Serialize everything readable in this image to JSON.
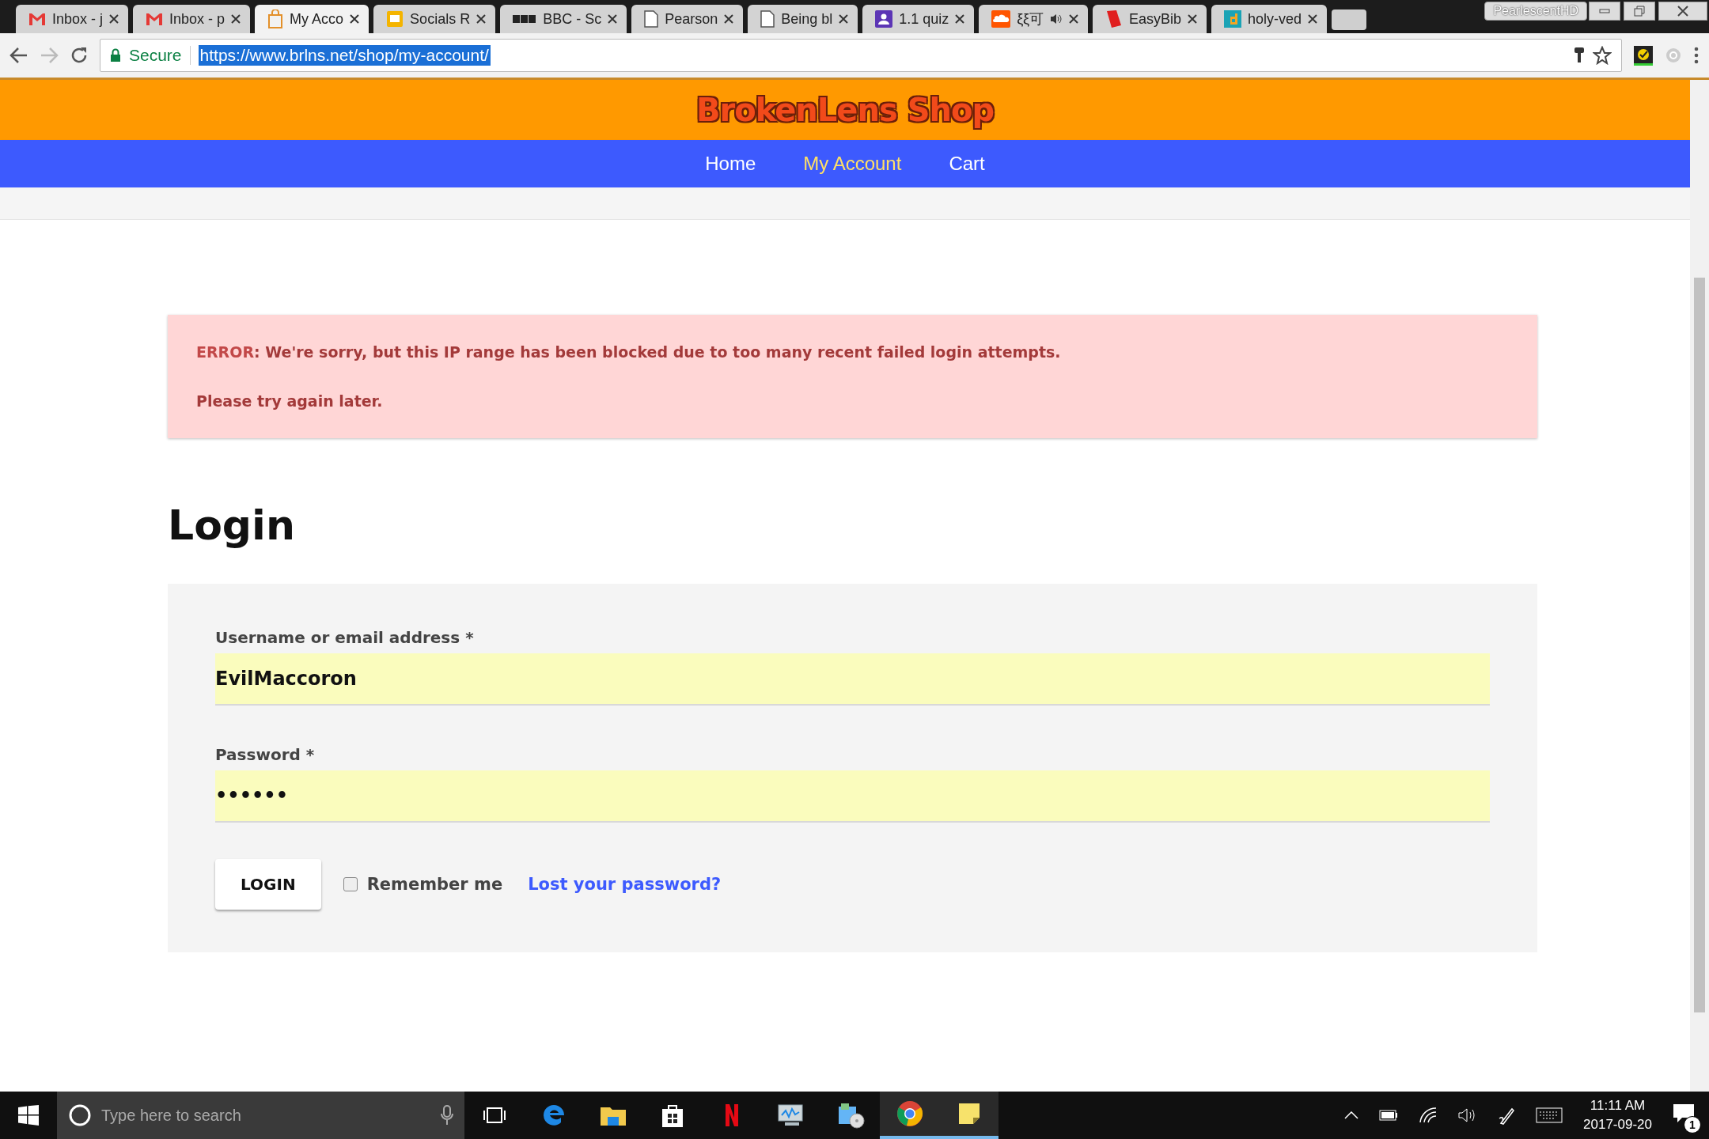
{
  "browser": {
    "tabs": [
      {
        "label": "Inbox - j",
        "selected": false,
        "audio": false
      },
      {
        "label": "Inbox - p",
        "selected": false,
        "audio": false
      },
      {
        "label": "My Acco",
        "selected": true,
        "audio": false
      },
      {
        "label": "Socials R",
        "selected": false,
        "audio": false
      },
      {
        "label": "BBC - Sc",
        "selected": false,
        "audio": false
      },
      {
        "label": "Pearson",
        "selected": false,
        "audio": false
      },
      {
        "label": "Being bl",
        "selected": false,
        "audio": false
      },
      {
        "label": "1.1 quiz",
        "selected": false,
        "audio": false
      },
      {
        "label": "ξξ可",
        "selected": false,
        "audio": true
      },
      {
        "label": "EasyBib",
        "selected": false,
        "audio": false
      },
      {
        "label": "holy-ved",
        "selected": false,
        "audio": false
      }
    ],
    "profile": "PearlescentHD",
    "secure_label": "Secure",
    "url": {
      "value": "https://www.brlns.net/shop/my-account/",
      "selected": true
    }
  },
  "site": {
    "logo": "BrokenLens Shop",
    "nav": [
      {
        "label": "Home",
        "selected": false
      },
      {
        "label": "My Account",
        "selected": true
      },
      {
        "label": "Cart",
        "selected": false
      }
    ]
  },
  "error": {
    "lines": [
      "**ERROR**: We're sorry, but this IP range has been blocked due to too many recent failed login attempts.",
      "Please try again later."
    ]
  },
  "login": {
    "heading": "Login",
    "fields": [
      {
        "label": "Username or email address *",
        "value": "EvilMaccoron"
      },
      {
        "label": "Password *",
        "value": "••••••"
      }
    ],
    "button": "LOGIN",
    "remember": {
      "label": "Remember me",
      "checked": false
    },
    "lost_link": "Lost your password?"
  },
  "taskbar": {
    "search": {
      "placeholder": "Type here to search"
    },
    "apps": [
      {
        "active": false
      },
      {
        "active": false
      },
      {
        "active": false
      },
      {
        "active": false
      },
      {
        "active": false
      },
      {
        "active": false
      },
      {
        "active": false
      },
      {
        "active": true
      },
      {
        "active": true
      }
    ],
    "time": "11:11 AM",
    "date": "2017-09-20",
    "notifications": "1"
  }
}
